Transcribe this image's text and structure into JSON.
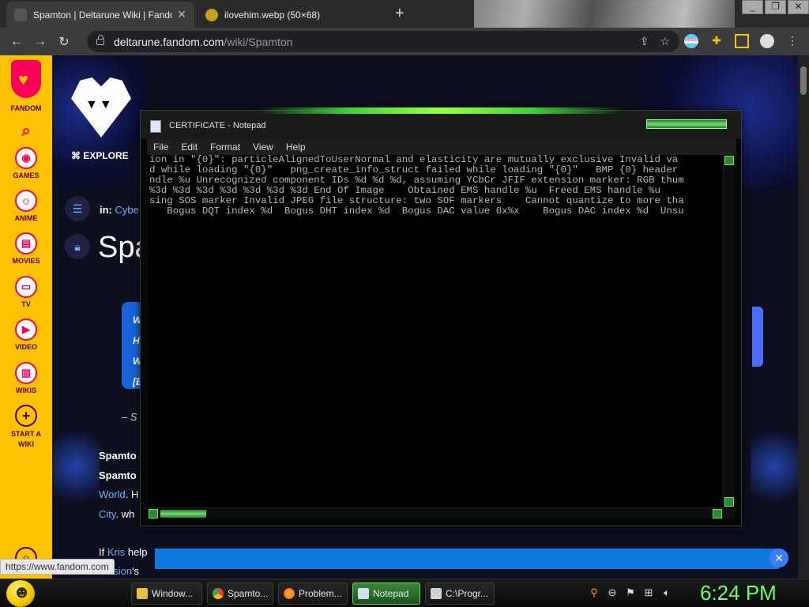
{
  "browser": {
    "tabs": [
      {
        "title": "Spamton | Deltarune Wiki | Fando",
        "active": true,
        "favicon_color": "#555555"
      },
      {
        "title": "ilovehim.webp (50×68)",
        "active": false,
        "favicon_color": "#c8a020"
      }
    ],
    "new_tab_label": "+",
    "close_label": "✕",
    "url_host": "deltarune.fandom.com",
    "url_path": "/wiki/Spamton",
    "status_url": "https://www.fandom.com"
  },
  "fandom_sidebar": {
    "logo_label": "FANDOM",
    "items": [
      {
        "label": "GAMES",
        "icon": "gamepad-icon"
      },
      {
        "label": "ANIME",
        "icon": "anime-icon"
      },
      {
        "label": "MOVIES",
        "icon": "film-icon"
      },
      {
        "label": "TV",
        "icon": "tv-icon"
      },
      {
        "label": "VIDEO",
        "icon": "video-icon"
      },
      {
        "label": "WIKIS",
        "icon": "book-icon"
      },
      {
        "label": "START A WIKI",
        "icon": "plus-icon"
      }
    ]
  },
  "page": {
    "explore_label": "EXPLORE",
    "crumb_prefix": "in:",
    "crumb_link": "Cybe",
    "title": "Spa",
    "quote_lines": [
      "W",
      "H",
      "W",
      "[E"
    ],
    "quote_attribution": "– S",
    "body_lines": [
      {
        "bold": "Spamto",
        "link": ""
      },
      {
        "bold": "Spamto",
        "link": ""
      },
      {
        "bold": "",
        "link": "World",
        "rest": ". H"
      },
      {
        "bold": "",
        "link": "City",
        "rest": ". wh"
      }
    ],
    "body_if_prefix": "If ",
    "body_if_link": "Kris",
    "body_if_rest": " help",
    "body_last_link": "nsion",
    "body_last_rest": "'s"
  },
  "notepad": {
    "title": "CERTIFICATE - Notepad",
    "menu": [
      "File",
      "Edit",
      "Format",
      "View",
      "Help"
    ],
    "lines": [
      "ion in \"{0}\": particleAlignedToUserNormal and elasticity are mutually exclusive Invalid va",
      "d while loading \"{0}\"   png_create_info_struct failed while loading \"{0}\"   BMP {0} header",
      "ndle %u Unrecognized component IDs %d %d %d, assuming YCbCr JFIF extension marker: RGB thum",
      "%3d %3d %3d %3d %3d %3d %3d End Of Image    Obtained EMS handle %u  Freed EMS handle %u",
      "sing SOS marker Invalid JPEG file structure: two SOF markers    Cannot quantize to more tha",
      "   Bogus DQT index %d  Bogus DHT index %d  Bogus DAC value 0x%x    Bogus DAC index %d  Unsu"
    ]
  },
  "taskbar": {
    "buttons": [
      {
        "label": "Window...",
        "icon_color": "#e8c040",
        "active": false
      },
      {
        "label": "Spamto...",
        "icon_color": "#4285f4",
        "active": false
      },
      {
        "label": "Problem...",
        "icon_color": "#ff7a1a",
        "active": false
      },
      {
        "label": "Notepad",
        "icon_color": "#cfe0f0",
        "active": true
      },
      {
        "label": "C:\\Progr...",
        "icon_color": "#d0d0d0",
        "active": false
      }
    ],
    "clock": "6:24 PM"
  },
  "colors": {
    "fandom_yellow": "#fec300",
    "fandom_pink": "#fa005a",
    "theme_green": "#6bff6b",
    "link_blue": "#6ab0ff"
  }
}
